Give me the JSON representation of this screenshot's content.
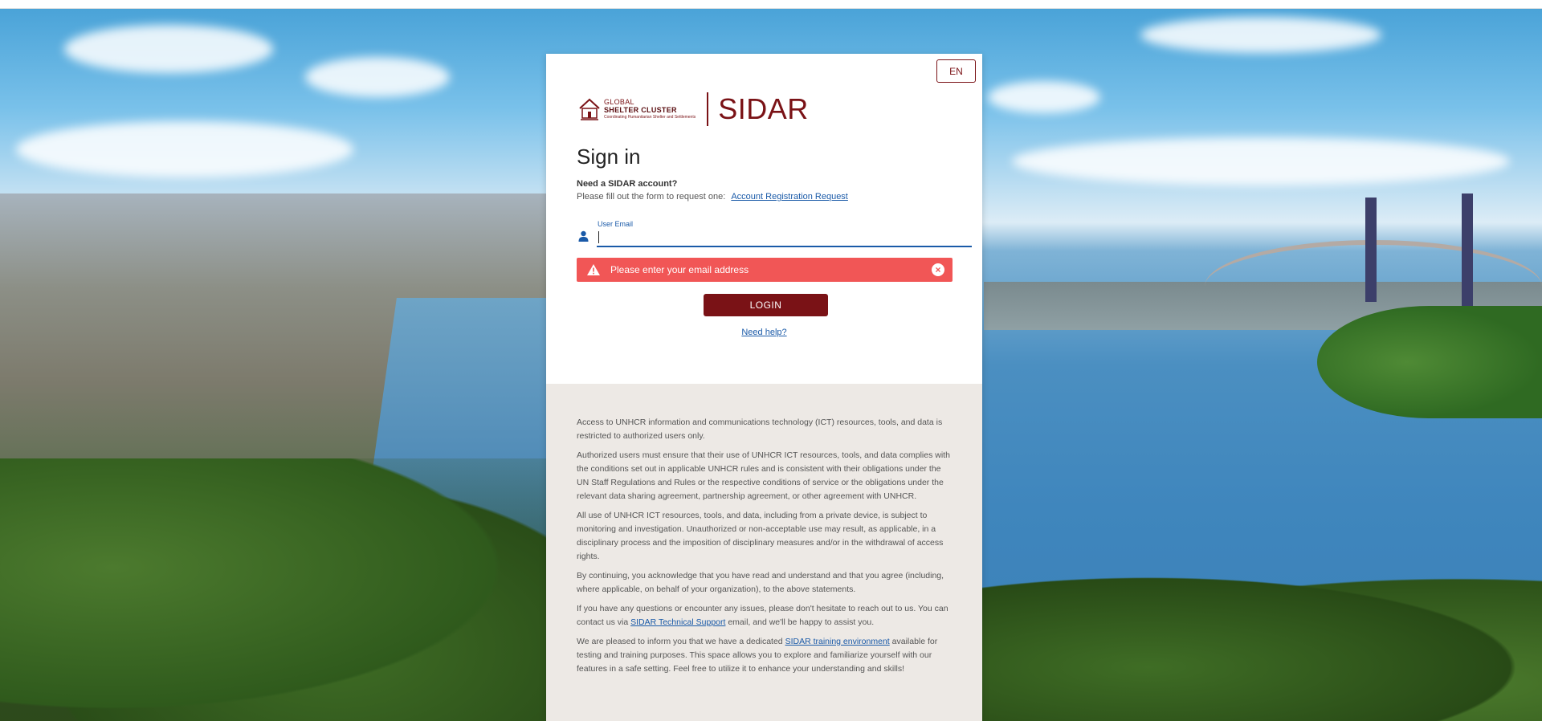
{
  "language": "EN",
  "brand": {
    "org_line1": "GLOBAL",
    "org_line2": "SHELTER CLUSTER",
    "org_tagline": "Coordinating Humanitarian Shelter and Settlements",
    "app_name": "SIDAR"
  },
  "signin": {
    "title": "Sign in",
    "need_account": "Need a SIDAR account?",
    "fill_form": "Please fill out the form to request one:",
    "registration_link": "Account Registration Request",
    "email_label": "User Email",
    "email_value": "",
    "error_message": "Please enter your email address",
    "login_label": "LOGIN",
    "help_link": "Need help?"
  },
  "notice": {
    "p1": "Access to UNHCR information and communications technology (ICT) resources, tools, and data is restricted to authorized users only.",
    "p2": "Authorized users must ensure that their use of UNHCR ICT resources, tools, and data complies with the conditions set out in applicable UNHCR rules and is consistent with their obligations under the UN Staff Regulations and Rules or the respective conditions of service or the obligations under the relevant data sharing agreement, partnership agreement, or other agreement with UNHCR.",
    "p3": "All use of UNHCR ICT resources, tools, and data, including from a private device, is subject to monitoring and investigation. Unauthorized or non-acceptable use may result, as applicable, in a disciplinary process and the imposition of disciplinary measures and/or in the withdrawal of access rights.",
    "p4": "By continuing, you acknowledge that you have read and understand and that you agree (including, where applicable, on behalf of your organization), to the above statements.",
    "p5_before": "If you have any questions or encounter any issues, please don't hesitate to reach out to us. You can contact us via",
    "p5_link": "SIDAR Technical Support",
    "p5_after": "email, and we'll be happy to assist you.",
    "p6_before": "We are pleased to inform you that we have a dedicated",
    "p6_link": "SIDAR training environment",
    "p6_after": "available for testing and training purposes. This space allows you to explore and familiarize yourself with our features in a safe setting. Feel free to utilize it to enhance your understanding and skills!"
  },
  "colors": {
    "brand": "#7a1216",
    "link": "#1a5aa8",
    "error": "#f15656",
    "notice_bg": "#ede9e5"
  },
  "icons": [
    "user-icon",
    "warning-icon",
    "close-icon"
  ]
}
